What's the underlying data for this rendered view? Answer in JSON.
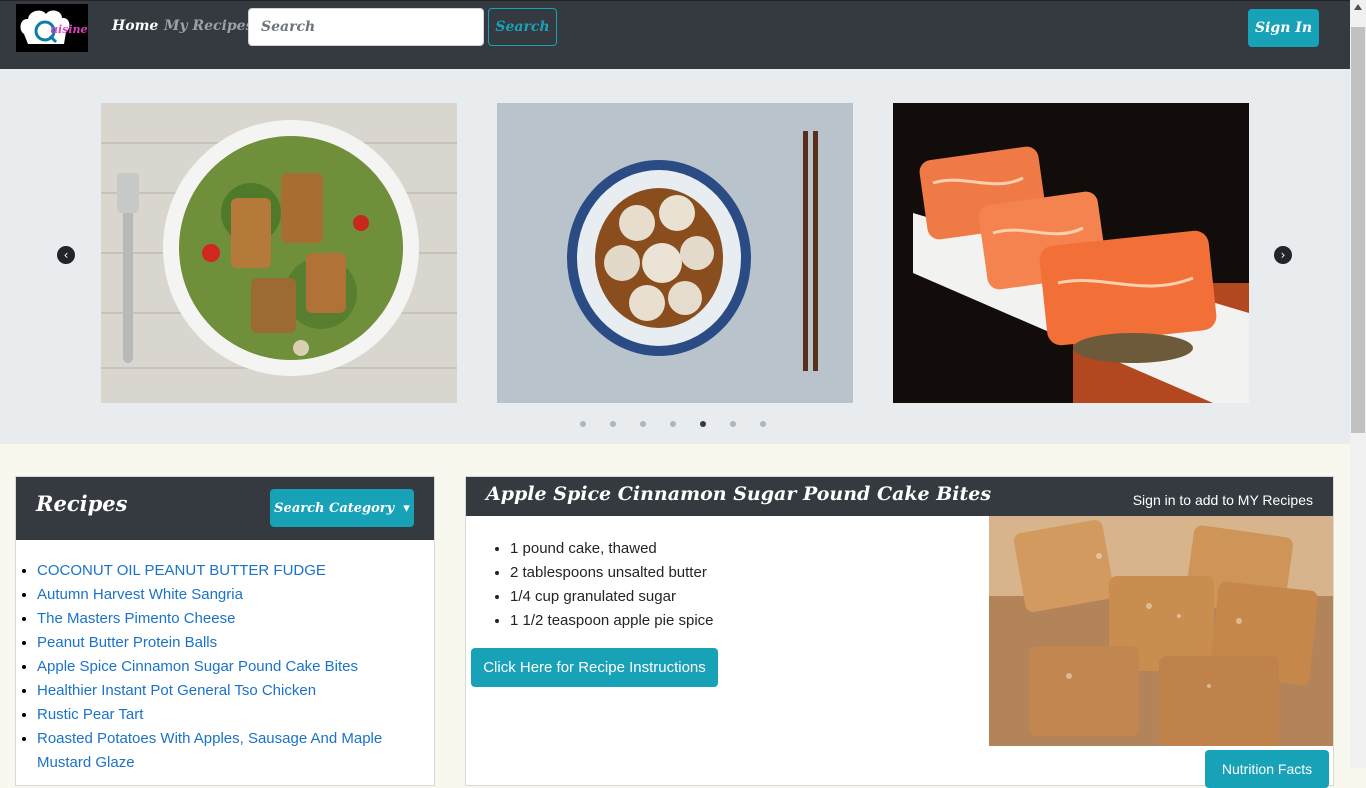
{
  "navbar": {
    "logo_text": "uisine",
    "nav_links": [
      "Home",
      "My Recipes"
    ],
    "search_placeholder": "Search",
    "search_value": "",
    "search_button": "Search",
    "signin_button": "Sign In"
  },
  "carousel": {
    "slides": [
      "salad-with-grilled-halloumi",
      "dumpling-soup-with-chopsticks",
      "salmon-sashimi-plate"
    ],
    "indicator_count": 7,
    "active_indicator": 5,
    "prev_icon": "chevron-left-icon",
    "next_icon": "chevron-right-icon"
  },
  "recipes": {
    "title": "Recipes",
    "category_button": "Search Category",
    "items": [
      "COCONUT OIL PEANUT BUTTER FUDGE",
      "Autumn Harvest White Sangria",
      "The Masters Pimento Cheese",
      "Peanut Butter Protein Balls",
      "Apple Spice Cinnamon Sugar Pound Cake Bites",
      "Healthier Instant Pot General Tso Chicken",
      "Rustic Pear Tart",
      "Roasted Potatoes With Apples, Sausage And Maple Mustard Glaze"
    ]
  },
  "detail": {
    "title": "Apple Spice Cinnamon Sugar Pound Cake Bites",
    "add_text": "Sign in to add to MY Recipes",
    "ingredients": [
      "1 pound cake, thawed",
      "2 tablespoons unsalted butter",
      "1/4 cup granulated sugar",
      "1 1/2 teaspoon apple pie spice"
    ],
    "instructions_button": "Click Here for Recipe Instructions",
    "nutrition_button": "Nutrition Facts"
  },
  "colors": {
    "navbar_bg": "#343a40",
    "accent": "#17a2b8",
    "link": "#1a73c9",
    "carousel_bg": "#e9ecef",
    "page_bg": "#f8f8ef"
  }
}
